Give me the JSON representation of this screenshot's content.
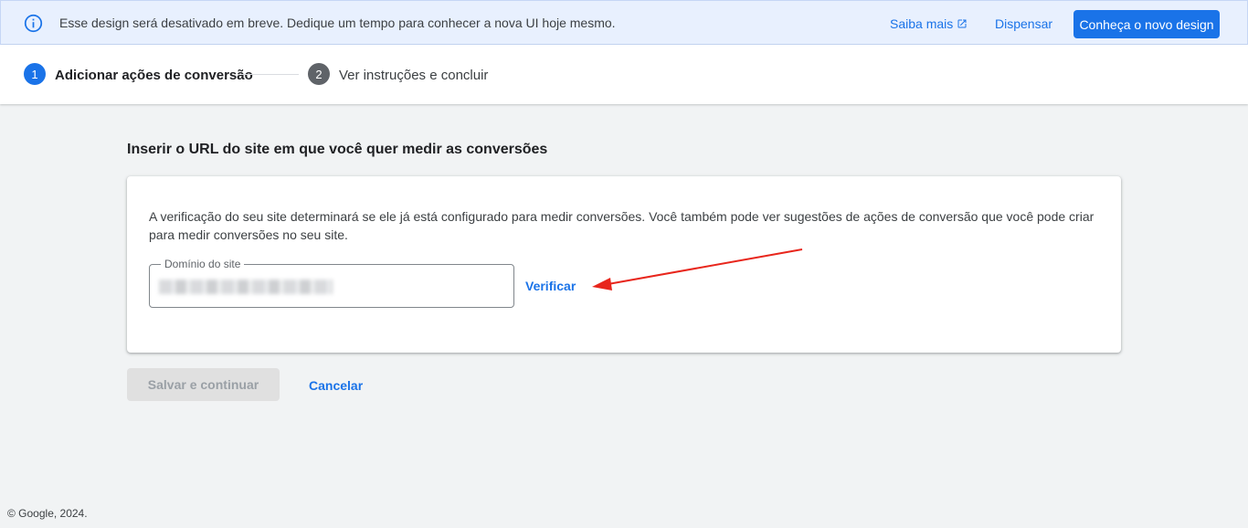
{
  "banner": {
    "info_icon": "info-circle-icon",
    "message": "Esse design será desativado em breve. Dedique um tempo para conhecer a nova UI hoje mesmo.",
    "learn_more": "Saiba mais",
    "learn_more_icon": "external-link-icon",
    "dismiss": "Dispensar",
    "cta": "Conheça o novo design"
  },
  "stepper": {
    "steps": [
      {
        "number": "1",
        "label": "Adicionar ações de conversão",
        "active": true
      },
      {
        "number": "2",
        "label": "Ver instruções e concluir",
        "active": false
      }
    ]
  },
  "main": {
    "title": "Inserir o URL do site em que você quer medir as conversões",
    "description": "A verificação do seu site determinará se ele já está configurado para medir conversões. Você também pode ver sugestões de ações de conversão que você pode criar para medir conversões no seu site.",
    "field_label": "Domínio do site",
    "field_value": "",
    "verify": "Verificar"
  },
  "actions": {
    "save": "Salvar e continuar",
    "cancel": "Cancelar"
  },
  "footer": "© Google, 2024.",
  "colors": {
    "accent": "#1a73e8",
    "banner_bg": "#e8f0fe",
    "arrow": "#e8261c"
  }
}
